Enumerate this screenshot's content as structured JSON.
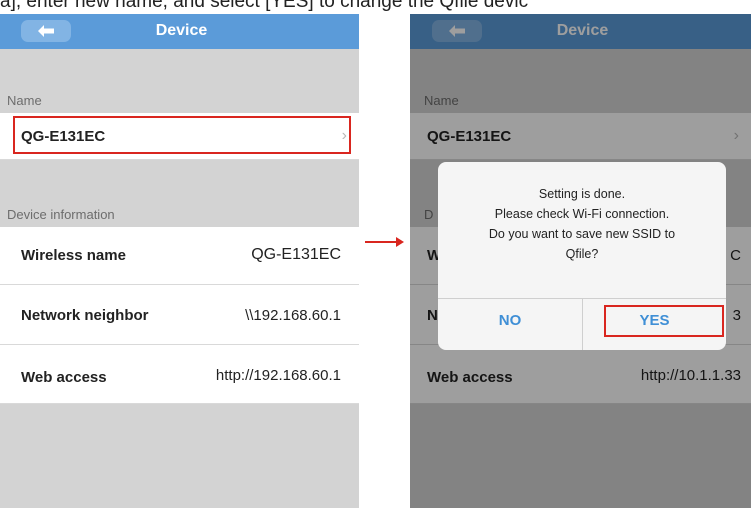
{
  "caption": "a], enter new name, and select [YES] to change the Qfile devic",
  "left": {
    "nav_title": "Device",
    "name_section": "Name",
    "device_name": "QG-E131EC",
    "info_section": "Device information",
    "rows": [
      {
        "label": "Wireless name",
        "value": "QG-E131EC"
      },
      {
        "label": "Network neighbor",
        "value": "\\\\192.168.60.1"
      },
      {
        "label": "Web access",
        "value": "http://192.168.60.1"
      }
    ]
  },
  "right": {
    "nav_title": "Device",
    "name_section": "Name",
    "device_name": "QG-E131EC",
    "info_section_partial": "D",
    "rows": [
      {
        "label_partial": "W",
        "value_partial": "C"
      },
      {
        "label_partial": "N",
        "value_partial": "3"
      },
      {
        "label": "Web access",
        "value": "http://10.1.1.33"
      }
    ],
    "dialog": {
      "lines": [
        "Setting is done.",
        "Please check Wi-Fi connection.",
        "Do you want to save new SSID to",
        "Qfile?"
      ],
      "no_label": "NO",
      "yes_label": "YES"
    }
  },
  "colors": {
    "navbar": "#5b9bd9",
    "highlight": "#d9261f",
    "dialog_button": "#3f8fd6"
  }
}
